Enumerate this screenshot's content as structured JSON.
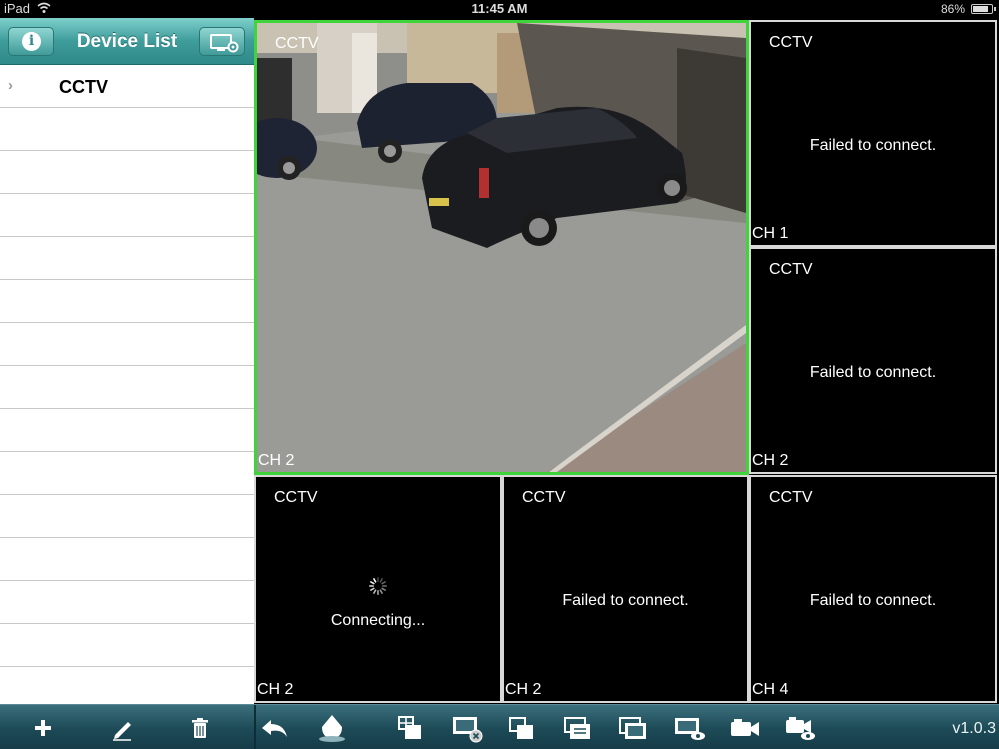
{
  "status_bar": {
    "device": "iPad",
    "time": "11:45 AM",
    "battery": "86%",
    "battery_level": 0.86
  },
  "sidebar": {
    "title": "Device List",
    "devices": [
      {
        "label": "CCTV"
      }
    ]
  },
  "cells": [
    {
      "name": "CCTV",
      "channel": "CH 2",
      "status": "",
      "selected": true
    },
    {
      "name": "CCTV",
      "channel": "CH 1",
      "status": "Failed to connect."
    },
    {
      "name": "CCTV",
      "channel": "CH 2",
      "status": "Failed to connect."
    },
    {
      "name": "CCTV",
      "channel": "CH 2",
      "status": "Connecting..."
    },
    {
      "name": "CCTV",
      "channel": "CH 2",
      "status": "Failed to connect."
    },
    {
      "name": "CCTV",
      "channel": "CH 4",
      "status": "Failed to connect."
    }
  ],
  "toolbar": {
    "version": "v1.0.3",
    "left_icons": [
      "add-icon",
      "edit-icon",
      "trash-icon"
    ],
    "right_icons": [
      "back-icon",
      "ptz-icon",
      "layout-split-icon",
      "close-view-icon",
      "single-view-icon",
      "multi-view-icon",
      "fullscreen-icon",
      "live-view-icon",
      "record-icon",
      "playback-icon"
    ]
  },
  "colors": {
    "accent_teal": "#3e9c9a",
    "selected_border": "#3fd43a",
    "toolbar": "#1d4a57"
  }
}
